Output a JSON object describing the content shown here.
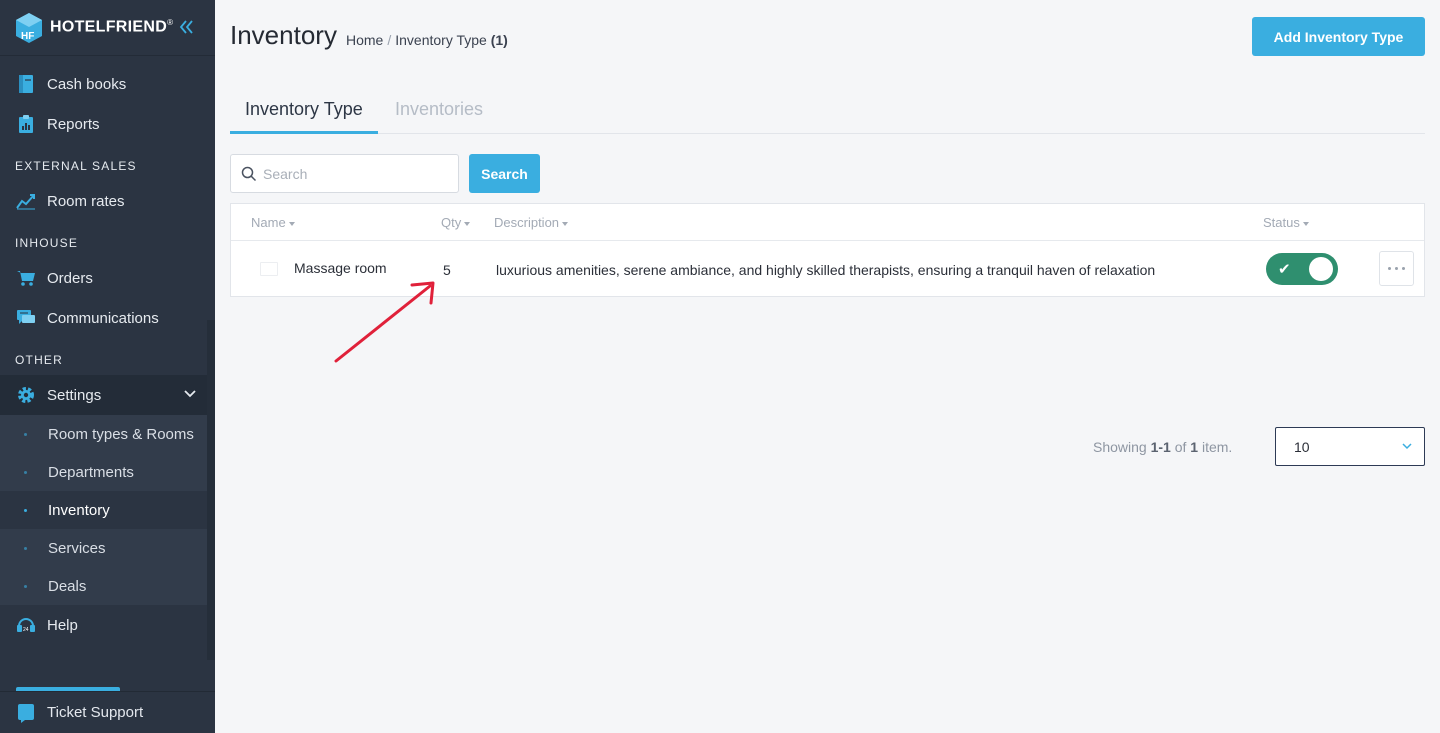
{
  "brand": {
    "name": "HOTELFRIEND",
    "registered": "®",
    "accent": "#3aaee0"
  },
  "sidebar": {
    "items_top": [
      {
        "label": "Cash books",
        "icon": "cash-book-icon"
      },
      {
        "label": "Reports",
        "icon": "reports-icon"
      }
    ],
    "sections": {
      "external_sales": "EXTERNAL SALES",
      "inhouse": "INHOUSE",
      "other": "OTHER"
    },
    "room_rates": {
      "label": "Room rates",
      "icon": "chart-line-icon"
    },
    "orders": {
      "label": "Orders",
      "icon": "cart-icon"
    },
    "communications": {
      "label": "Communications",
      "icon": "chat-icon"
    },
    "settings": {
      "label": "Settings",
      "icon": "gear-icon",
      "expanded": true,
      "children": [
        {
          "label": "Room types & Rooms",
          "active": false
        },
        {
          "label": "Departments",
          "active": false
        },
        {
          "label": "Inventory",
          "active": true
        },
        {
          "label": "Services",
          "active": false
        },
        {
          "label": "Deals",
          "active": false
        }
      ]
    },
    "help": {
      "label": "Help",
      "icon": "headset-icon"
    },
    "ticket_support": {
      "label": "Ticket Support",
      "icon": "ticket-icon"
    }
  },
  "header": {
    "title": "Inventory",
    "breadcrumb": {
      "home": "Home",
      "separator": "/",
      "current": "Inventory Type",
      "count": "(1)"
    },
    "add_button": "Add Inventory Type"
  },
  "tabs": [
    {
      "label": "Inventory Type",
      "active": true
    },
    {
      "label": "Inventories",
      "active": false
    }
  ],
  "search": {
    "placeholder": "Search",
    "value": "",
    "button": "Search"
  },
  "table": {
    "columns": [
      "Name",
      "Qty",
      "Description",
      "Status"
    ],
    "rows": [
      {
        "name": "Massage room",
        "qty": "5",
        "description": "luxurious amenities, serene ambiance, and highly skilled therapists, ensuring a tranquil haven of relaxation",
        "status_enabled": true
      }
    ]
  },
  "pagination": {
    "showing_prefix": "Showing",
    "range": "1-1",
    "of": "of",
    "total": "1",
    "suffix": "item.",
    "per_page": "10"
  },
  "annotation": {
    "type": "arrow",
    "color": "#e0213a",
    "points_to": "qty-cell"
  }
}
